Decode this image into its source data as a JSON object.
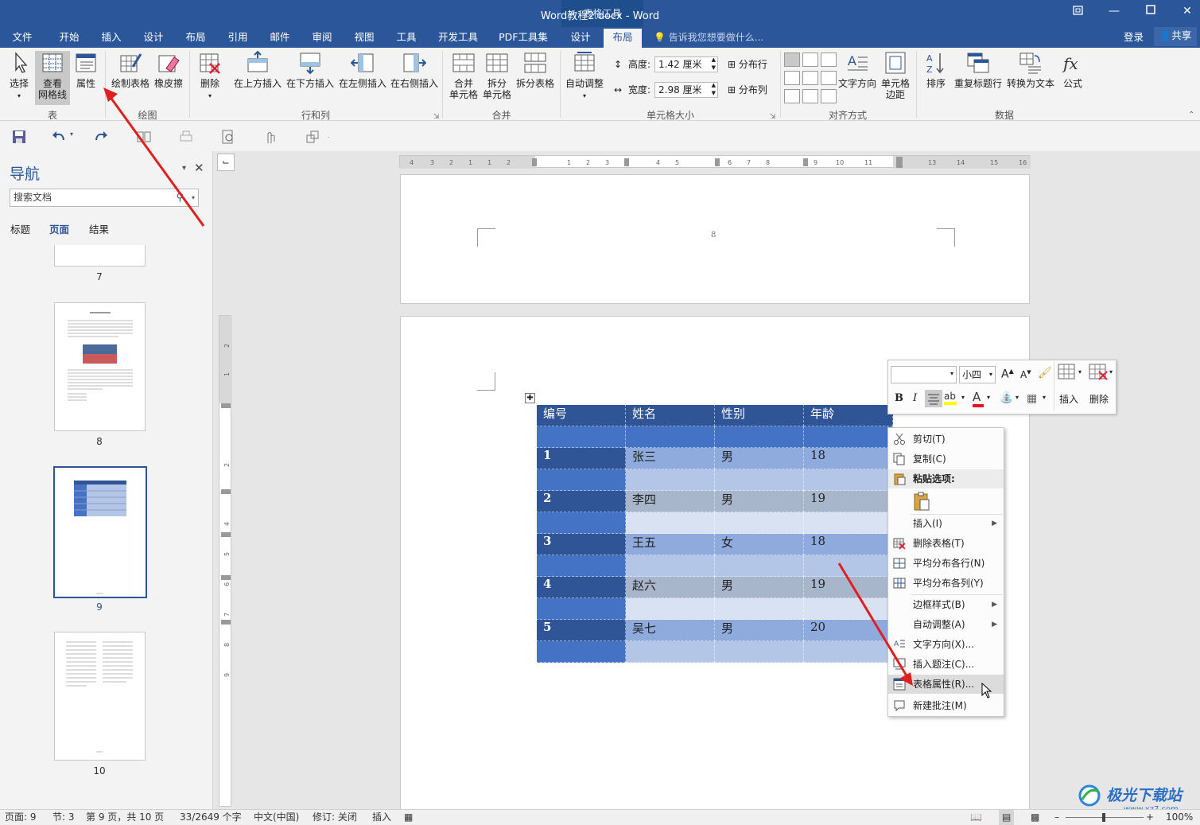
{
  "window": {
    "title": "Word教程2.docx - Word",
    "contextual_tab_group": "表格工具",
    "restore_icon": "restore-icon",
    "minimize_icon": "minimize-icon",
    "maximize_icon": "maximize-icon",
    "close_icon": "close-icon"
  },
  "tabs": [
    "文件",
    "开始",
    "插入",
    "设计",
    "布局",
    "引用",
    "邮件",
    "审阅",
    "视图",
    "工具",
    "开发工具",
    "PDF工具集",
    "设计",
    "布局"
  ],
  "tab_active_index": 13,
  "tell_me": "告诉我您想要做什么...",
  "login": "登录",
  "share": "共享",
  "ribbon": {
    "table_group": {
      "label": "表",
      "select": "选择",
      "gridlines_1": "查看",
      "gridlines_2": "网格线",
      "properties": "属性"
    },
    "draw_group": {
      "label": "绘图",
      "draw_table": "绘制表格",
      "eraser": "橡皮擦"
    },
    "rowcol_group": {
      "label": "行和列",
      "delete": "删除",
      "insert_above": "在上方插入",
      "insert_below": "在下方插入",
      "insert_left": "在左侧插入",
      "insert_right": "在右侧插入"
    },
    "merge_group": {
      "label": "合并",
      "merge_1": "合并",
      "merge_2": "单元格",
      "split_1": "拆分",
      "split_2": "单元格",
      "split_table": "拆分表格"
    },
    "cellsize_group": {
      "label": "单元格大小",
      "autofit": "自动调整",
      "height_label": "高度:",
      "height_value": "1.42 厘米",
      "width_label": "宽度:",
      "width_value": "2.98 厘米",
      "distribute_rows": "分布行",
      "distribute_cols": "分布列"
    },
    "align_group": {
      "label": "对齐方式",
      "text_direction": "文字方向",
      "cell_margins_1": "单元格",
      "cell_margins_2": "边距"
    },
    "data_group": {
      "label": "数据",
      "sort": "排序",
      "repeat_header": "重复标题行",
      "convert_text": "转换为文本",
      "formula": "公式"
    }
  },
  "quick_access": {
    "save_icon": "save-icon",
    "undo_icon": "undo-icon",
    "redo_icon": "redo-icon"
  },
  "navigation": {
    "title": "导航",
    "search_placeholder": "搜索文档",
    "tabs": [
      "标题",
      "页面",
      "结果"
    ],
    "active_tab": 1,
    "thumbnails": [
      "7",
      "8",
      "9",
      "10"
    ],
    "selected_page": "9"
  },
  "document": {
    "page_number_text": "8",
    "table": {
      "headers": [
        "编号",
        "姓名",
        "性别",
        "年龄"
      ],
      "rows": [
        [
          "1",
          "张三",
          "男",
          "18"
        ],
        [
          "2",
          "李四",
          "男",
          "19"
        ],
        [
          "3",
          "王五",
          "女",
          "18"
        ],
        [
          "4",
          "赵六",
          "男",
          "19"
        ],
        [
          "5",
          "吴七",
          "男",
          "20"
        ]
      ]
    }
  },
  "mini_toolbar": {
    "font_size": "小四",
    "bold": "B",
    "italic": "I",
    "insert": "插入",
    "delete": "删除"
  },
  "context_menu": {
    "items": [
      {
        "label": "剪切(T)",
        "icon": "cut-icon"
      },
      {
        "label": "复制(C)",
        "icon": "copy-icon"
      },
      {
        "label": "粘贴选项:",
        "icon": "paste-icon"
      },
      {
        "label": "插入(I)",
        "icon": ""
      },
      {
        "label": "删除表格(T)",
        "icon": "delete-table-icon"
      },
      {
        "label": "平均分布各行(N)",
        "icon": "distribute-rows-icon"
      },
      {
        "label": "平均分布各列(Y)",
        "icon": "distribute-cols-icon"
      },
      {
        "label": "边框样式(B)",
        "icon": ""
      },
      {
        "label": "自动调整(A)",
        "icon": ""
      },
      {
        "label": "文字方向(X)...",
        "icon": "text-direction-icon"
      },
      {
        "label": "插入题注(C)...",
        "icon": "caption-icon"
      },
      {
        "label": "表格属性(R)...",
        "icon": "table-properties-icon"
      },
      {
        "label": "新建批注(M)",
        "icon": "comment-icon"
      }
    ],
    "highlighted_index": 11
  },
  "status_bar": {
    "page": "页面: 9",
    "section": "节: 3",
    "page_of": "第 9 页，共 10 页",
    "words": "33/2649 个字",
    "language": "中文(中国)",
    "track_changes": "修订: 关闭",
    "insert_mode": "插入",
    "zoom": "100%"
  },
  "watermark": {
    "brand": "极光下载站",
    "url": "www.xz7.com"
  },
  "colors": {
    "word_blue": "#2b579a",
    "table_header": "#2f5597",
    "table_dark": "#4472c4",
    "table_light": "#b4c6e7",
    "table_lighter": "#d9e2f3",
    "arrow_red": "#e02020"
  }
}
